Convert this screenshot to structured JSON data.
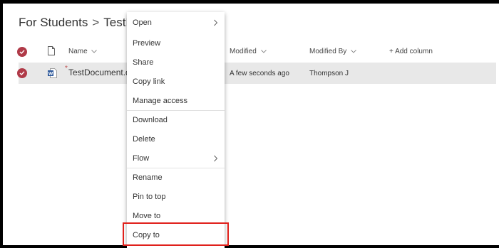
{
  "breadcrumb": {
    "parent": "For Students",
    "separator": ">",
    "current": "TestFol"
  },
  "columns": {
    "name": "Name",
    "modified": "Modified",
    "modified_by": "Modified By",
    "add_column": "+ Add column"
  },
  "file": {
    "name": "TestDocument.do",
    "new_indicator": "*",
    "modified": "A few seconds ago",
    "modified_by": "Thompson J"
  },
  "context_menu": {
    "open": "Open",
    "preview": "Preview",
    "share": "Share",
    "copy_link": "Copy link",
    "manage_access": "Manage access",
    "download": "Download",
    "delete": "Delete",
    "flow": "Flow",
    "rename": "Rename",
    "pin_to_top": "Pin to top",
    "move_to": "Move to",
    "copy_to": "Copy to"
  },
  "colors": {
    "check": "#b03a48",
    "selected_row": "#e8e8e8",
    "highlight_border": "#e0201b",
    "word_blue": "#2b579a"
  },
  "icons": {
    "chevron": "chevron-down-icon",
    "submenu": "chevron-right-icon",
    "word": "word-file-icon",
    "document": "document-icon",
    "check": "checkmark-circle-icon"
  }
}
